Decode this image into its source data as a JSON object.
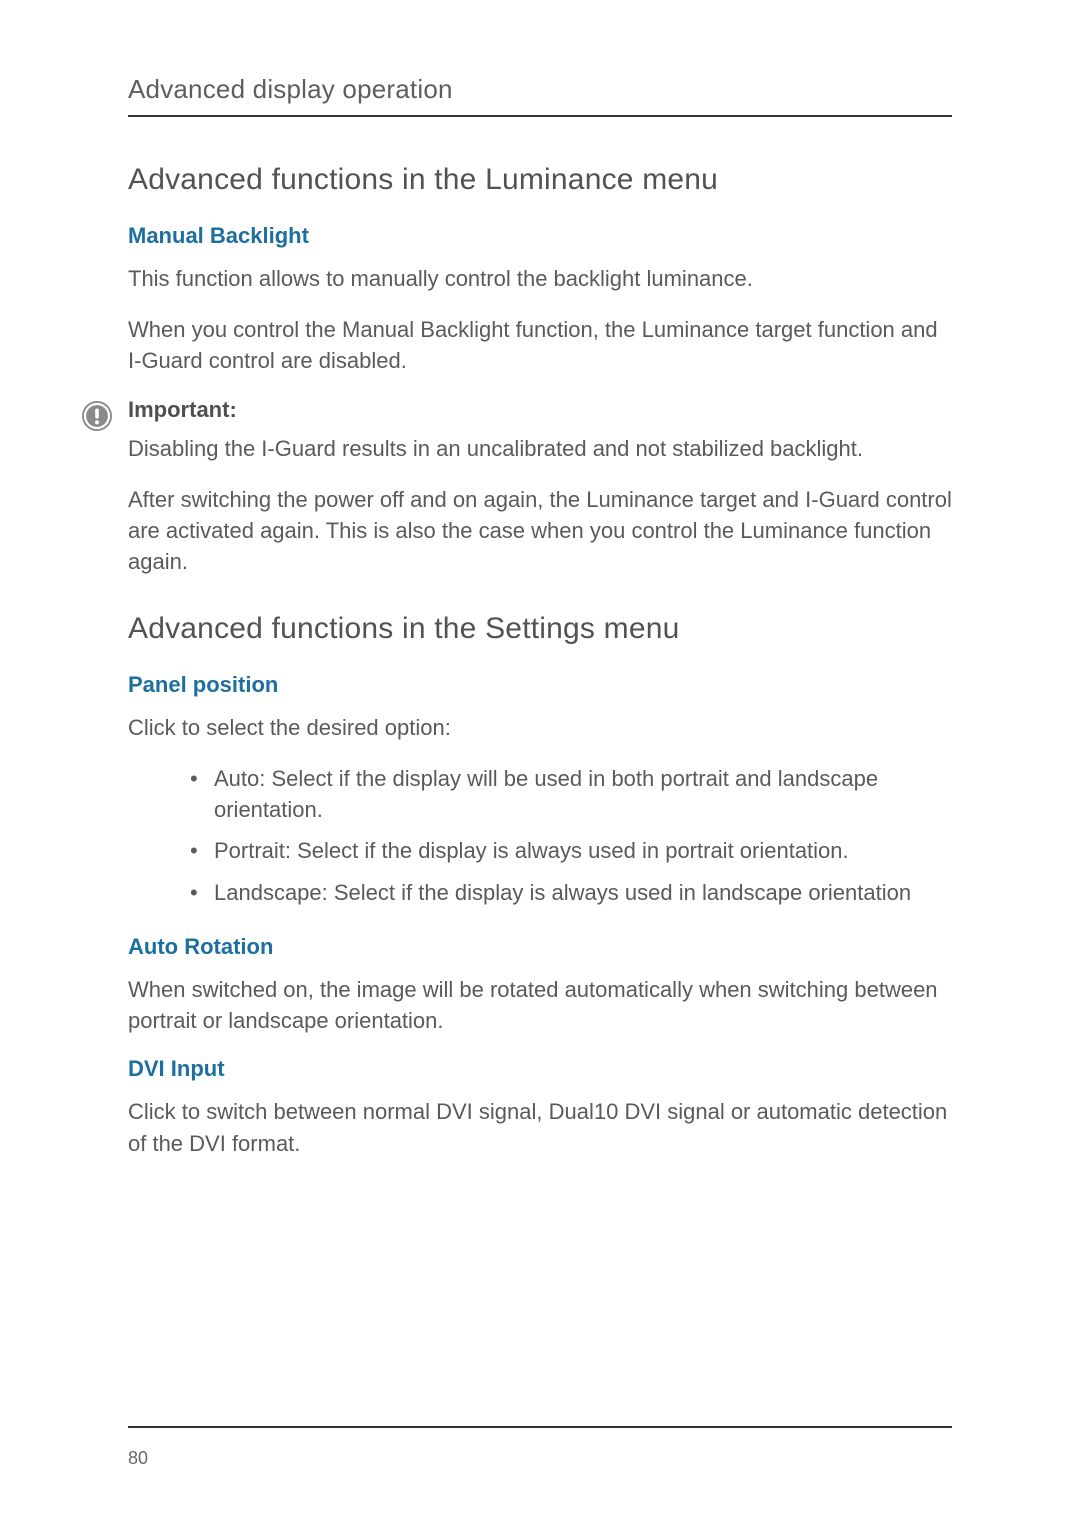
{
  "running_header": "Advanced display operation",
  "section1": {
    "title": "Advanced functions in the Luminance menu",
    "manual_backlight": {
      "heading": "Manual Backlight",
      "p1": "This function allows to manually control the backlight luminance.",
      "p2": "When you control the Manual Backlight function, the Luminance target function and I-Guard control are disabled."
    },
    "important": {
      "label": "Important:",
      "p1": "Disabling the I-Guard results in an uncalibrated and not stabilized backlight.",
      "p2": "After switching the power off and on again, the Luminance target and I-Guard control are activated again. This is also the case when you control the Luminance function again."
    }
  },
  "section2": {
    "title": "Advanced functions in the Settings menu",
    "panel_position": {
      "heading": "Panel position",
      "intro": "Click to select the desired option:",
      "options": [
        "Auto: Select if the display will be used in both portrait and landscape orientation.",
        "Portrait: Select if the display is always used in portrait orientation.",
        "Landscape: Select if the display is always used in landscape orientation"
      ]
    },
    "auto_rotation": {
      "heading": "Auto Rotation",
      "p1": "When switched on, the image will be rotated automatically when switching between portrait or landscape orientation."
    },
    "dvi_input": {
      "heading": "DVI Input",
      "p1": "Click to switch between normal DVI signal, Dual10 DVI signal or automatic detection of the DVI format."
    }
  },
  "page_number": "80"
}
